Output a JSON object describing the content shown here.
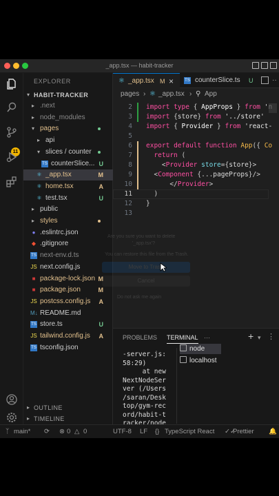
{
  "window": {
    "title": "_app.tsx — habit-tracker"
  },
  "explorer": {
    "heading": "EXPLORER",
    "project": "HABIT-TRACKER",
    "items": [
      {
        "name": ".next",
        "kind": "folder",
        "indent": 1,
        "color": "#8a8a8a",
        "mark": "",
        "markColor": "",
        "dot": ""
      },
      {
        "name": "node_modules",
        "kind": "folder",
        "indent": 1,
        "color": "#8a8a8a",
        "mark": "",
        "markColor": "",
        "dot": ""
      },
      {
        "name": "pages",
        "kind": "folder-open",
        "indent": 1,
        "color": "#e2c08d",
        "mark": "",
        "markColor": "",
        "dot": "#73c991"
      },
      {
        "name": "api",
        "kind": "folder",
        "indent": 2,
        "color": "#cccccc",
        "mark": "",
        "markColor": "",
        "dot": ""
      },
      {
        "name": "slices / counter",
        "kind": "folder-open",
        "indent": 2,
        "color": "#cccccc",
        "mark": "",
        "markColor": "",
        "dot": "#73c991"
      },
      {
        "name": "counterSlice...",
        "kind": "ts",
        "indent": 3,
        "color": "#cccccc",
        "mark": "U",
        "markColor": "#73c991",
        "dot": ""
      },
      {
        "name": "_app.tsx",
        "kind": "react",
        "indent": 2,
        "color": "#e2c08d",
        "mark": "M",
        "markColor": "#e2c08d",
        "dot": ""
      },
      {
        "name": "home.tsx",
        "kind": "react",
        "indent": 2,
        "color": "#e2c08d",
        "mark": "A",
        "markColor": "#e2c08d",
        "dot": ""
      },
      {
        "name": "test.tsx",
        "kind": "react",
        "indent": 2,
        "color": "#cccccc",
        "mark": "U",
        "markColor": "#73c991",
        "dot": ""
      },
      {
        "name": "public",
        "kind": "folder",
        "indent": 1,
        "color": "#cccccc",
        "mark": "",
        "markColor": "",
        "dot": ""
      },
      {
        "name": "styles",
        "kind": "folder",
        "indent": 1,
        "color": "#e2c08d",
        "mark": "",
        "markColor": "",
        "dot": "#e2c08d"
      },
      {
        "name": ".eslintrc.json",
        "kind": "eslint",
        "indent": 1,
        "color": "#cccccc",
        "mark": "",
        "markColor": "",
        "dot": ""
      },
      {
        "name": ".gitignore",
        "kind": "git",
        "indent": 1,
        "color": "#cccccc",
        "mark": "",
        "markColor": "",
        "dot": ""
      },
      {
        "name": "next-env.d.ts",
        "kind": "ts",
        "indent": 1,
        "color": "#8a8a8a",
        "mark": "",
        "markColor": "",
        "dot": ""
      },
      {
        "name": "next.config.js",
        "kind": "js",
        "indent": 1,
        "color": "#cccccc",
        "mark": "",
        "markColor": "",
        "dot": ""
      },
      {
        "name": "package-lock.json",
        "kind": "npm",
        "indent": 1,
        "color": "#e2c08d",
        "mark": "M",
        "markColor": "#e2c08d",
        "dot": ""
      },
      {
        "name": "package.json",
        "kind": "npm",
        "indent": 1,
        "color": "#e2c08d",
        "mark": "M",
        "markColor": "#e2c08d",
        "dot": ""
      },
      {
        "name": "postcss.config.js",
        "kind": "js",
        "indent": 1,
        "color": "#e2c08d",
        "mark": "A",
        "markColor": "#e2c08d",
        "dot": ""
      },
      {
        "name": "README.md",
        "kind": "md",
        "indent": 1,
        "color": "#cccccc",
        "mark": "",
        "markColor": "",
        "dot": ""
      },
      {
        "name": "store.ts",
        "kind": "ts",
        "indent": 1,
        "color": "#cccccc",
        "mark": "U",
        "markColor": "#73c991",
        "dot": ""
      },
      {
        "name": "tailwind.config.js",
        "kind": "js",
        "indent": 1,
        "color": "#e2c08d",
        "mark": "A",
        "markColor": "#e2c08d",
        "dot": ""
      },
      {
        "name": "tsconfig.json",
        "kind": "ts-config",
        "indent": 1,
        "color": "#cccccc",
        "mark": "",
        "markColor": "",
        "dot": ""
      }
    ],
    "outline": "OUTLINE",
    "timeline": "TIMELINE"
  },
  "activity": {
    "scm_badge": "11"
  },
  "tabs": [
    {
      "label": "_app.tsx",
      "mark": "M",
      "close": "×",
      "active": true
    },
    {
      "label": "counterSlice.ts",
      "mark": "U",
      "active": false
    }
  ],
  "breadcrumb": {
    "folder": "pages",
    "file": "_app.tsx",
    "symbol": "App"
  },
  "code": {
    "lines": [
      {
        "n": "2",
        "html": "<span class='kw'>import</span> <span class='kw'>type</span> <span class='punct'>{</span> <span class='ty'>AppProps</span> <span class='punct'>}</span> <span class='kw'>from</span> <span class='str'>'n</span>"
      },
      {
        "n": "3",
        "html": "<span class='kw'>import</span> <span class='punct'>{</span><span class='var'>store</span><span class='punct'>}</span> <span class='kw'>from</span> <span class='str'>'../store'</span>"
      },
      {
        "n": "4",
        "html": "<span class='kw'>import</span> <span class='punct'>{</span> <span class='ty'>Provider</span> <span class='punct'>}</span> <span class='kw'>from</span> <span class='str'>'react-</span>"
      },
      {
        "n": "5",
        "html": ""
      },
      {
        "n": "6",
        "html": "<span class='kw'>export</span> <span class='kw'>default</span> <span class='kw'>function</span> <span class='fn'>App</span><span class='punct'>({</span> <span class='fn'>Co</span>"
      },
      {
        "n": "7",
        "html": "  <span class='kw'>return</span> <span class='punct'>(</span>"
      },
      {
        "n": "8",
        "html": "    <span class='punct'>&lt;</span><span class='tag'>Provider</span> <span class='attr'>store</span><span class='punct'>={</span><span class='var'>store</span><span class='punct'>}&gt;</span>"
      },
      {
        "n": "9",
        "html": "  <span class='punct'>&lt;</span><span class='tag'>Component</span> <span class='punct'>{...</span><span class='var'>pageProps</span><span class='punct'>}/&gt;</span>"
      },
      {
        "n": "10",
        "html": "      <span class='punct'>&lt;/</span><span class='tag'>Provider</span><span class='punct'>&gt;</span>"
      },
      {
        "n": "11",
        "html": "  <span class='punct'>)</span>"
      },
      {
        "n": "12",
        "html": "<span class='punct'>}</span>"
      },
      {
        "n": "13",
        "html": ""
      }
    ]
  },
  "dialog": {
    "question": "Are you sure you want to delete",
    "file": "'_app.tsx'?",
    "detail": "You can restore this file from the Trash.",
    "primary": "Move to Trash",
    "secondary": "Cancel",
    "checkbox": "Do not ask me again"
  },
  "panel": {
    "tabs": [
      "PROBLEMS",
      "TERMINAL"
    ],
    "active_tab": "TERMINAL",
    "more": "···",
    "add": "+",
    "terminal_output": "-server.js:\n58:29)\n     at new\nNextNodeSer\nver (/Users\n/saran/Desk\ntop/gym-rec\nord/habit-t\nracker/node",
    "terminals": [
      "node",
      "localhost"
    ]
  },
  "status": {
    "branch": "main*",
    "errors": "0",
    "warnings": "0",
    "encoding": "UTF-8",
    "eol": "LF",
    "language": "TypeScript React",
    "formatter": "Prettier"
  }
}
